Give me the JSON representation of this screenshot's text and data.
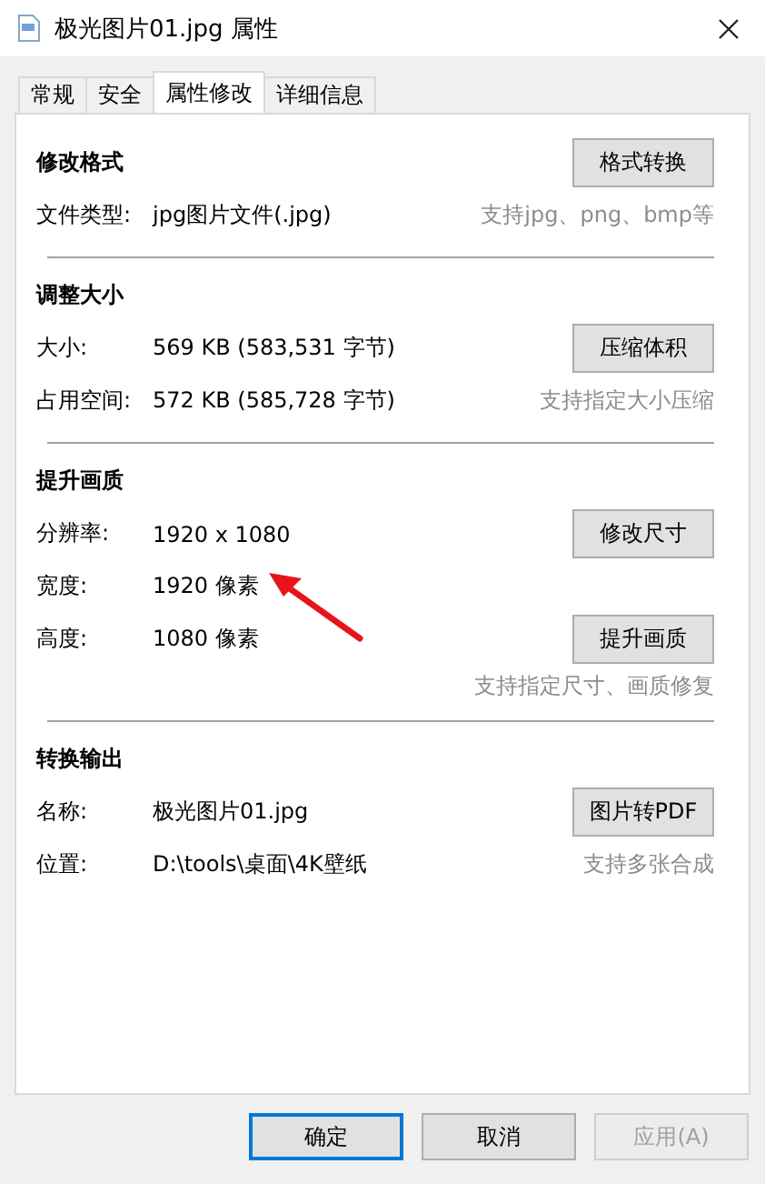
{
  "window": {
    "title": "极光图片01.jpg 属性"
  },
  "tabs": [
    {
      "label": "常规",
      "selected": false
    },
    {
      "label": "安全",
      "selected": false
    },
    {
      "label": "属性修改",
      "selected": true
    },
    {
      "label": "详细信息",
      "selected": false
    }
  ],
  "sections": [
    {
      "title": "修改格式",
      "button": "格式转换",
      "rows": [
        {
          "label": "文件类型:",
          "value": "jpg图片文件(.jpg)",
          "note": "支持jpg、png、bmp等"
        }
      ]
    },
    {
      "title": "调整大小",
      "rows": [
        {
          "label": "大小:",
          "value": "569 KB (583,531 字节)",
          "button": "压缩体积"
        },
        {
          "label": "占用空间:",
          "value": "572 KB (585,728 字节)",
          "note": "支持指定大小压缩"
        }
      ]
    },
    {
      "title": "提升画质",
      "rows": [
        {
          "label": "分辨率:",
          "value": "1920 x 1080",
          "button": "修改尺寸"
        },
        {
          "label": "宽度:",
          "value": "1920 像素"
        },
        {
          "label": "高度:",
          "value": "1080 像素",
          "button": "提升画质"
        }
      ],
      "note": "支持指定尺寸、画质修复"
    },
    {
      "title": "转换输出",
      "rows": [
        {
          "label": "名称:",
          "value": "极光图片01.jpg",
          "button": "图片转PDF"
        },
        {
          "label": "位置:",
          "value": "D:\\tools\\桌面\\4K壁纸",
          "note": "支持多张合成"
        }
      ]
    }
  ],
  "footer_buttons": [
    {
      "label": "确定",
      "default": true,
      "disabled": false
    },
    {
      "label": "取消",
      "default": false,
      "disabled": false
    },
    {
      "label": "应用(A)",
      "default": false,
      "disabled": true
    }
  ]
}
